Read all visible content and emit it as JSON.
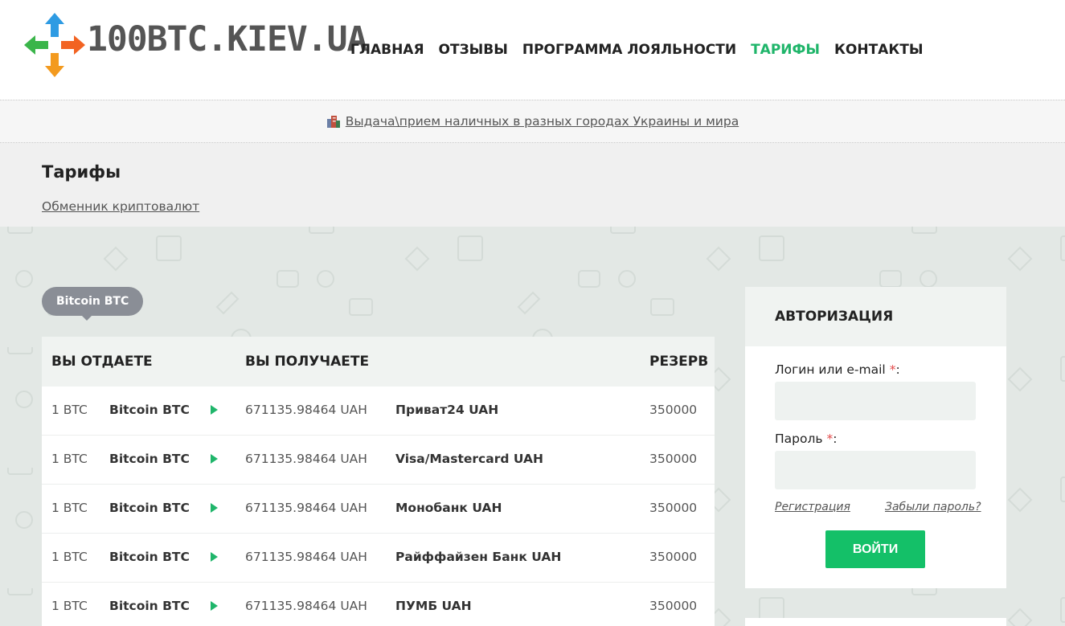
{
  "logo": {
    "text": "100BTC.KIEV.UA"
  },
  "nav": [
    {
      "label": "ГЛАВНАЯ",
      "active": false
    },
    {
      "label": "ОТЗЫВЫ",
      "active": false
    },
    {
      "label": "ПРОГРАММА ЛОЯЛЬНОСТИ",
      "active": false
    },
    {
      "label": "ТАРИФЫ",
      "active": true
    },
    {
      "label": "КОНТАКТЫ",
      "active": false
    }
  ],
  "notice": {
    "icon": "city-buildings-icon",
    "text": "Выдача\\прием наличных в разных городах Украины и мира"
  },
  "page": {
    "title": "Тарифы",
    "breadcrumb": "Обменник криптовалют"
  },
  "tariffs": {
    "tag": "Bitcoin BTC",
    "headers": {
      "give": "ВЫ ОТДАЕТЕ",
      "get": "ВЫ ПОЛУЧАЕТЕ",
      "reserve": "РЕЗЕРВ"
    },
    "rows": [
      {
        "amount": "1 BTC",
        "from": "Bitcoin BTC",
        "rate": "671135.98464 UAH",
        "to": "Приват24 UAH",
        "reserve": "350000"
      },
      {
        "amount": "1 BTC",
        "from": "Bitcoin BTC",
        "rate": "671135.98464 UAH",
        "to": "Visa/Mastercard UAH",
        "reserve": "350000"
      },
      {
        "amount": "1 BTC",
        "from": "Bitcoin BTC",
        "rate": "671135.98464 UAH",
        "to": "Монобанк UAH",
        "reserve": "350000"
      },
      {
        "amount": "1 BTC",
        "from": "Bitcoin BTC",
        "rate": "671135.98464 UAH",
        "to": "Райффайзен Банк UAH",
        "reserve": "350000"
      },
      {
        "amount": "1 BTC",
        "from": "Bitcoin BTC",
        "rate": "671135.98464 UAH",
        "to": "ПУМБ UAH",
        "reserve": "350000"
      }
    ]
  },
  "auth": {
    "title": "АВТОРИЗАЦИЯ",
    "login_label": "Логин или e-mail",
    "password_label": "Пароль",
    "required_mark": "*",
    "colon": ":",
    "register_link": "Регистрация",
    "forgot_link": "Забыли пароль?",
    "submit": "ВОЙТИ"
  },
  "colors": {
    "accent": "#1fb56a",
    "button": "#14c068",
    "tag": "#8a8e96",
    "logo_blue": "#2e9be3",
    "logo_green": "#3ab54a",
    "logo_orange": "#f39a1e",
    "logo_red": "#f26322"
  }
}
